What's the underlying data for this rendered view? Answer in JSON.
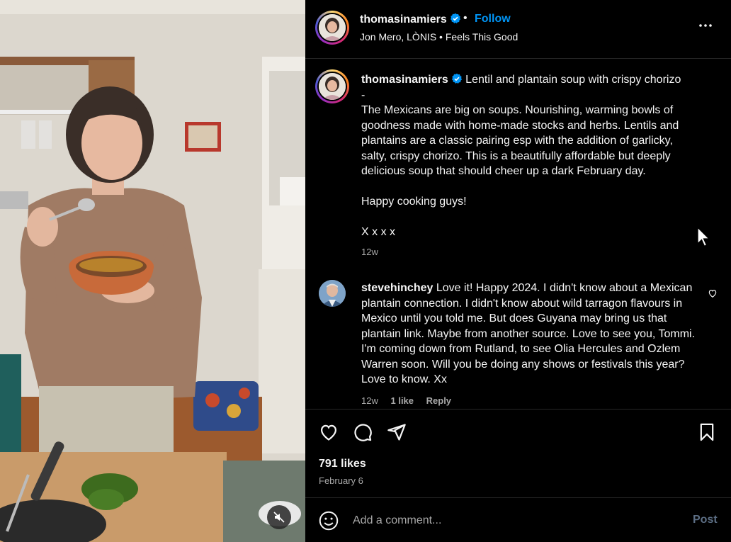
{
  "header": {
    "username": "thomasinamiers",
    "separator": "•",
    "follow_label": "Follow",
    "audio_line": "Jon Mero, LÒNIS • Feels This Good",
    "more_icon": "more-options-icon"
  },
  "caption": {
    "username": "thomasinamiers",
    "text": "Lentil and plantain soup with crispy chorizo\n-\nThe Mexicans are big on soups. Nourishing, warming bowls of goodness made with home-made stocks and herbs. Lentils and plantains are a classic pairing esp with the addition of garlicky, salty, crispy chorizo. This is a beautifully affordable but deeply delicious soup that should cheer up a dark February day.\n\nHappy cooking guys!\n\nX x x x",
    "time": "12w"
  },
  "comments": [
    {
      "username": "stevehinchey",
      "text": "Love it! Happy 2024. I didn't know about a Mexican plantain connection. I didn't know about wild tarragon flavours in Mexico until you told me. But does Guyana may bring us that plantain link. Maybe from another source. Love to see you, Tommi. I'm coming down from Rutland, to see Olia Hercules and Ozlem Warren soon. Will you be doing any shows or festivals this year? Love to know. Xx",
      "time": "12w",
      "likes": "1 like",
      "reply_label": "Reply"
    }
  ],
  "actions": {
    "likes": "791 likes",
    "date": "February 6"
  },
  "comment_box": {
    "placeholder": "Add a comment...",
    "post_label": "Post"
  },
  "colors": {
    "background": "#000000",
    "link_blue": "#0095f6",
    "secondary_text": "#a8a8a8",
    "divider": "#262626",
    "post_disabled": "#5c6e84"
  }
}
